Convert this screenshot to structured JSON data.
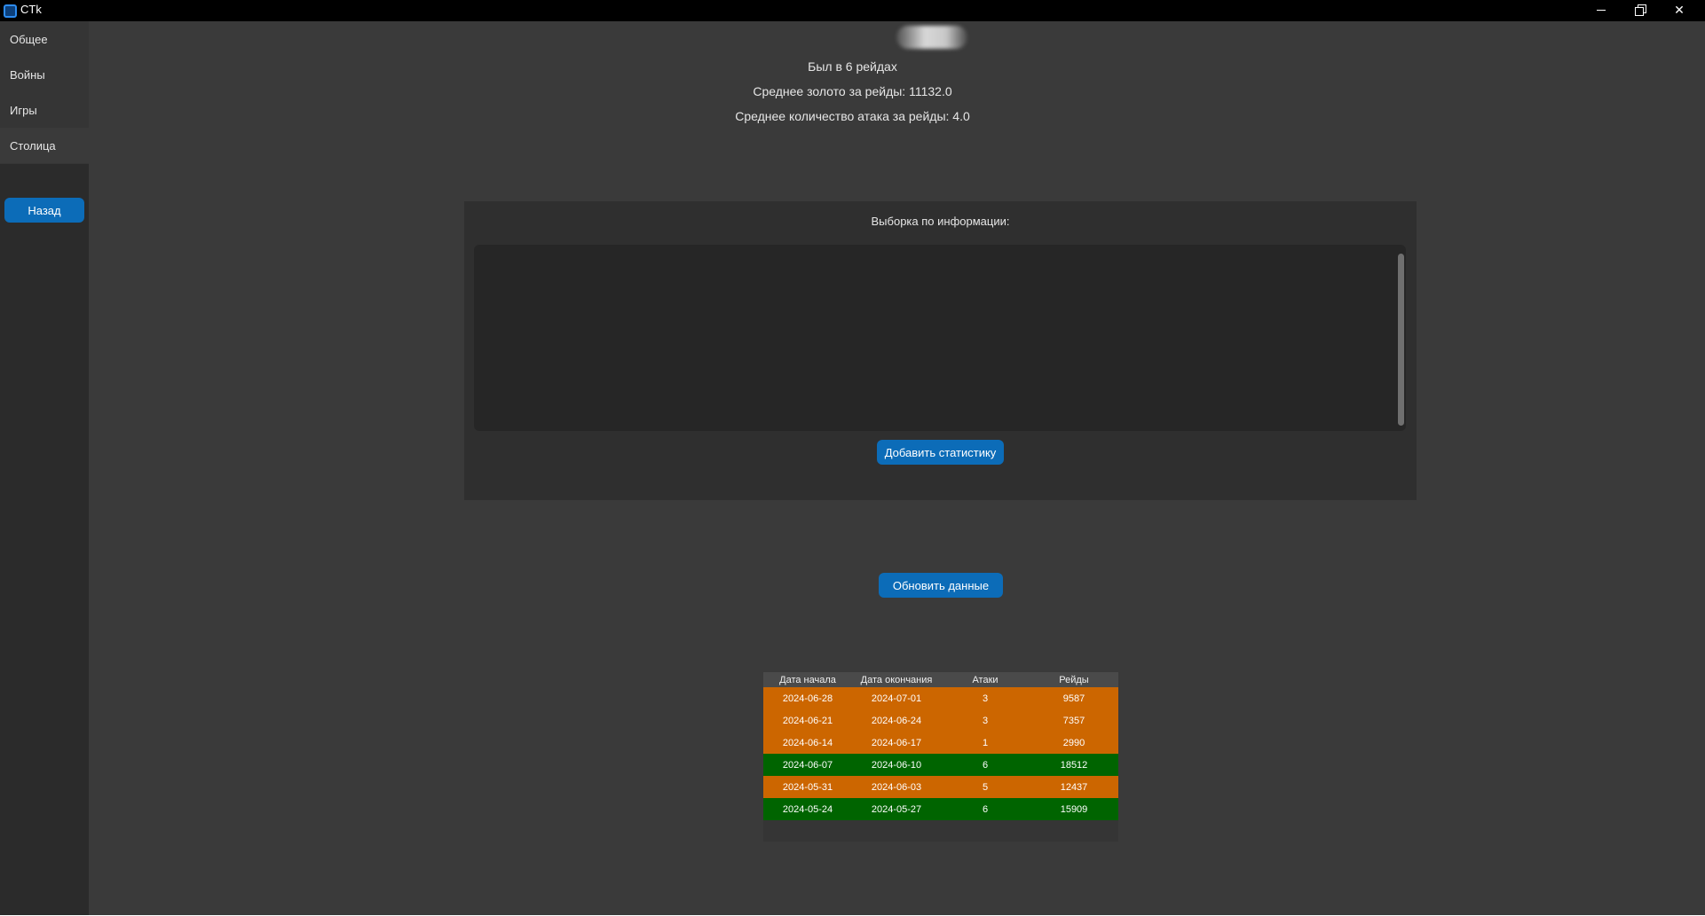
{
  "window": {
    "title": "CTk"
  },
  "sidebar": {
    "tabs": [
      {
        "label": "Общее"
      },
      {
        "label": "Войны"
      },
      {
        "label": "Игры"
      },
      {
        "label": "Столица",
        "active": true
      }
    ],
    "back_label": "Назад"
  },
  "stats": {
    "raids_line": "Был в 6 рейдах",
    "gold_line": "Среднее золото за рейды: 11132.0",
    "attacks_line": "Среднее количество атака за рейды: 4.0"
  },
  "panel": {
    "label": "Выборка по информации:",
    "textbox_value": "",
    "add_button": "Добавить статистику"
  },
  "refresh_button": "Обновить данные",
  "table": {
    "headers": [
      "Дата начала",
      "Дата окончания",
      "Атаки",
      "Рейды"
    ],
    "rows": [
      {
        "start": "2024-06-28",
        "end": "2024-07-01",
        "attacks": "3",
        "raids": "9587",
        "status": "orange"
      },
      {
        "start": "2024-06-21",
        "end": "2024-06-24",
        "attacks": "3",
        "raids": "7357",
        "status": "orange"
      },
      {
        "start": "2024-06-14",
        "end": "2024-06-17",
        "attacks": "1",
        "raids": "2990",
        "status": "orange"
      },
      {
        "start": "2024-06-07",
        "end": "2024-06-10",
        "attacks": "6",
        "raids": "18512",
        "status": "green"
      },
      {
        "start": "2024-05-31",
        "end": "2024-06-03",
        "attacks": "5",
        "raids": "12437",
        "status": "orange"
      },
      {
        "start": "2024-05-24",
        "end": "2024-05-27",
        "attacks": "6",
        "raids": "15909",
        "status": "green"
      }
    ],
    "row_colors": {
      "orange": "#cc6600",
      "green": "#006400"
    }
  },
  "colors": {
    "accent": "#0c6cb8",
    "background": "#3a3a3a",
    "sidebar": "#2b2b2b"
  }
}
